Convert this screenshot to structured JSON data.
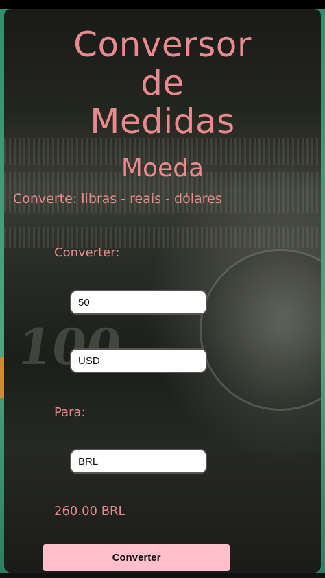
{
  "header": {
    "title_line1": "Conversor",
    "title_line2": "de",
    "title_line3": "Medidas",
    "subtitle": "Moeda",
    "description": "Converte: libras - reais - dólares"
  },
  "form": {
    "converter_label": "Converter:",
    "amount_value": "50",
    "from_currency_value": "USD",
    "para_label": "Para:",
    "to_currency_value": "BRL",
    "result": "260.00 BRL",
    "convert_button_label": "Converter"
  },
  "colors": {
    "accent_text": "#e98a8e",
    "button_bg": "#ffc0cb"
  }
}
